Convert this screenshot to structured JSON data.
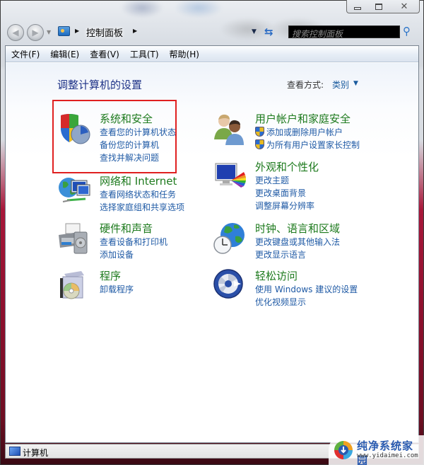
{
  "window": {
    "caption_buttons": {
      "minimize": "minimize",
      "maximize": "maximize",
      "close": "✕"
    }
  },
  "navbar": {
    "back_icon": "◀",
    "forward_icon": "▶",
    "history_dropdown_icon": "▼",
    "breadcrumb_separator": "▶",
    "breadcrumb": [
      "控制面板"
    ],
    "address_dropdown_icon": "▼",
    "refresh_icon": "⇆",
    "search_placeholder": "搜索控制面板",
    "search_value": "",
    "search_icon": "⚲"
  },
  "menubar": {
    "items": [
      "文件(F)",
      "编辑(E)",
      "查看(V)",
      "工具(T)",
      "帮助(H)"
    ]
  },
  "content": {
    "page_title": "调整计算机的设置",
    "view_by_label": "查看方式:",
    "view_by_value": "类别",
    "view_by_arrow": "▼",
    "highlight_color": "#e02020",
    "categories": [
      {
        "title": "系统和安全",
        "icon": "shield-pie-icon",
        "links": [
          "查看您的计算机状态",
          "备份您的计算机",
          "查找并解决问题"
        ]
      },
      {
        "title": "网络和 Internet",
        "icon": "network-globe-icon",
        "links": [
          "查看网络状态和任务",
          "选择家庭组和共享选项"
        ]
      },
      {
        "title": "硬件和声音",
        "icon": "printer-speaker-icon",
        "links": [
          "查看设备和打印机",
          "添加设备"
        ]
      },
      {
        "title": "程序",
        "icon": "program-box-icon",
        "links": [
          "卸载程序"
        ]
      },
      {
        "title": "用户帐户和家庭安全",
        "icon": "users-icon",
        "links": [
          "添加或删除用户帐户",
          "为所有用户设置家长控制"
        ]
      },
      {
        "title": "外观和个性化",
        "icon": "monitor-palette-icon",
        "links": [
          "更改主题",
          "更改桌面背景",
          "调整屏幕分辨率"
        ]
      },
      {
        "title": "时钟、语言和区域",
        "icon": "globe-clock-icon",
        "links": [
          "更改键盘或其他输入法",
          "更改显示语言"
        ]
      },
      {
        "title": "轻松访问",
        "icon": "ease-of-access-icon",
        "links": [
          "使用 Windows 建议的设置",
          "优化视频显示"
        ]
      }
    ]
  },
  "statusbar": {
    "text": "计算机"
  },
  "watermark": {
    "title": "纯净系统家园",
    "url": "www.yidaimei.com"
  }
}
